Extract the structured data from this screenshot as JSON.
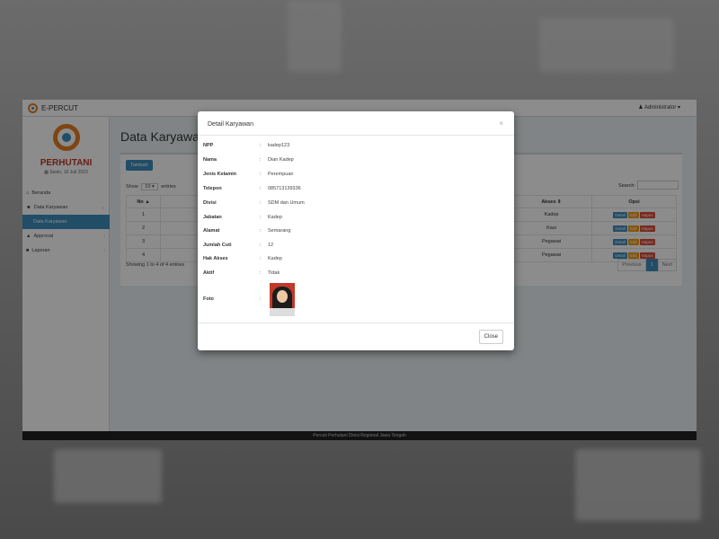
{
  "app": {
    "brand": "E-PERCUT",
    "user": "Administrator"
  },
  "sidebar": {
    "org": "PERHUTANI",
    "date": "Senin, 10 Juli 2023",
    "items": [
      {
        "label": "Beranda"
      },
      {
        "label": "Data Karyawan"
      },
      {
        "label": "Data Karyawan"
      },
      {
        "label": "Approval"
      },
      {
        "label": "Laporan"
      }
    ]
  },
  "main": {
    "title": "Data Karyawan",
    "add_label": "Tambah",
    "show_label": "Show",
    "entries_value": "10",
    "entries_label": "entries",
    "search_label": "Search:",
    "columns": {
      "no": "No",
      "akses": "Akses",
      "opsi": "Opsi"
    },
    "rows": [
      {
        "no": "1",
        "akses": "Kadep"
      },
      {
        "no": "2",
        "akses": "Kasi"
      },
      {
        "no": "3",
        "akses": "Pegawai"
      },
      {
        "no": "4",
        "akses": "Pegawai"
      }
    ],
    "btn_detail": "Detail",
    "btn_edit": "Edit",
    "btn_hapus": "Hapus",
    "info": "Showing 1 to 4 of 4 entries",
    "pager": {
      "prev": "Previous",
      "page": "1",
      "next": "Next"
    }
  },
  "footer": "Percuti Perhutani Divisi Regional Jawa Tengah",
  "modal": {
    "title": "Detail Karyawan",
    "close_x": "×",
    "fields": [
      {
        "k": "NPP",
        "v": "kadep123"
      },
      {
        "k": "Nama",
        "v": "Dian Kadep"
      },
      {
        "k": "Jenis Kelamin",
        "v": "Perempuan"
      },
      {
        "k": "Telepon",
        "v": "085713139336"
      },
      {
        "k": "Divisi",
        "v": "SDM dan Umum"
      },
      {
        "k": "Jabatan",
        "v": "Kadep"
      },
      {
        "k": "Alamat",
        "v": "Semarang"
      },
      {
        "k": "Jumlah Cuti",
        "v": "12"
      },
      {
        "k": "Hak Akses",
        "v": "Kadep"
      },
      {
        "k": "Aktif",
        "v": "Tidak"
      }
    ],
    "foto_label": "Foto",
    "colon": ":",
    "close_label": "Close"
  }
}
